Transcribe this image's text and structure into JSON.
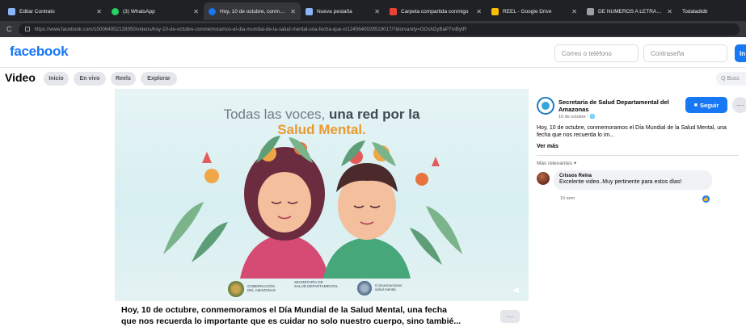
{
  "browser": {
    "tabs": [
      {
        "label": "Editar Contrato",
        "icon": "grid-icon",
        "color": "#8ab4f8",
        "active": false
      },
      {
        "label": "(3) WhatsApp",
        "icon": "whatsapp-icon",
        "color": "#25d366",
        "active": false
      },
      {
        "label": "Hoy, 10 de octubre, conmem",
        "icon": "facebook-icon",
        "color": "#1877f2",
        "active": true
      },
      {
        "label": "Nueva pestaña",
        "icon": "newtab-icon",
        "color": "#8ab4f8",
        "active": false
      },
      {
        "label": "Carpeta compartida conmigo",
        "icon": "gmail-icon",
        "color": "#ea4335",
        "active": false
      },
      {
        "label": "REEL - Google Drive",
        "icon": "drive-icon",
        "color": "#fbbc04",
        "active": false
      },
      {
        "label": "DE NUMEROS A LETRAS - E...",
        "icon": "doc-icon",
        "color": "#9aa0a6",
        "active": false
      },
      {
        "label": "Todaladidb",
        "icon": "doc-icon",
        "color": "#9aa0a6",
        "active": false
      }
    ],
    "url": "https://www.facebook.com/100064952128350/videos/hoy-10-de-octubre-conmemoramos-el-dia-mundial-de-la-salud-mental-una-fecha-que-n/1245640028519017/?idorvanity=OOsN2yBaP7mBytR"
  },
  "header": {
    "logo": "facebook",
    "email_placeholder": "Correo o teléfono",
    "password_placeholder": "Contraseña",
    "login_label": "In"
  },
  "videonav": {
    "title": "Video",
    "pills": [
      "Inicio",
      "En vivo",
      "Reels",
      "Explorar"
    ],
    "search_placeholder": "Q Busc"
  },
  "video": {
    "headline_prefix": "Todas las voces,",
    "headline_bold": "una red por la",
    "headline_accent": "Salud Mental.",
    "logos": [
      {
        "line1": "GOBERNACIÓN",
        "line2": "DEL AMAZONAS"
      },
      {
        "line1": "SECRETARÍA DE",
        "line2": "SALUD DEPARTAMENTAL"
      },
      {
        "line1": "Comunicaciones",
        "line2": "salud mental"
      }
    ]
  },
  "post": {
    "line1": "Hoy, 10 de octubre, conmemoramos el Día Mundial de la Salud Mental, una fecha",
    "line2": "que nos recuerda lo importante que es cuidar no solo nuestro cuerpo, sino tambié...",
    "more_label": "···"
  },
  "side": {
    "page_name": "Secretaría de Salud Departamental del Amazonas",
    "date": "10 de octubre · 🌐",
    "follow_label": "Seguir",
    "description": "Hoy, 10 de octubre, conmemoramos el Día Mundial de la Salud Mental, una fecha que nos recuerda lo im...",
    "see_more": "Ver más",
    "sort_label": "Más relevantes ▾",
    "comment": {
      "author": "Crissos Reina",
      "text": "Excelente video..Muy pertinente para estos días!",
      "time": "10 sem"
    }
  }
}
